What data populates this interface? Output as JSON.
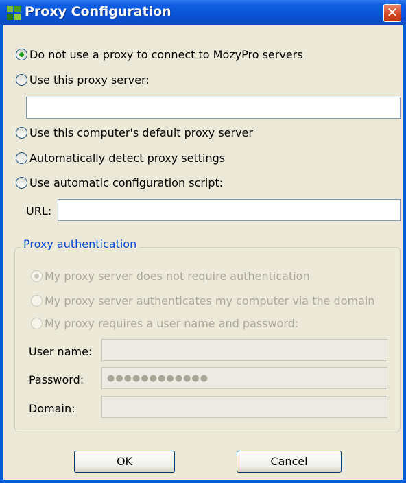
{
  "window": {
    "title": "Proxy Configuration",
    "close_glyph": "✕"
  },
  "proxy_options": [
    {
      "label": "Do not use a proxy to connect to MozyPro servers",
      "checked": true
    },
    {
      "label": "Use this proxy server:",
      "checked": false
    },
    {
      "label": "Use this computer's default proxy server",
      "checked": false
    },
    {
      "label": "Automatically detect proxy settings",
      "checked": false
    },
    {
      "label": "Use automatic configuration script:",
      "checked": false
    }
  ],
  "proxy_server_field": {
    "value": ""
  },
  "url_field": {
    "label": "URL:",
    "value": ""
  },
  "auth": {
    "title": "Proxy authentication",
    "options": [
      {
        "label": "My proxy server does not require authentication",
        "checked": true,
        "enabled": false
      },
      {
        "label": "My proxy server authenticates my computer via the domain",
        "checked": false,
        "enabled": false
      },
      {
        "label": "My proxy requires a user name and password:",
        "checked": false,
        "enabled": false
      }
    ],
    "username": {
      "label": "User name:",
      "value": ""
    },
    "password": {
      "label": "Password:",
      "value": "●●●●●●●●●●●●"
    },
    "domain": {
      "label": "Domain:",
      "value": ""
    }
  },
  "buttons": {
    "ok": "OK",
    "cancel": "Cancel"
  },
  "colors": {
    "titlebar": "#0A53D4",
    "dialog_bg": "#ECE9D8",
    "group_title": "#0046D5",
    "radio_dot": "#21A121",
    "close_button": "#D2431E"
  }
}
